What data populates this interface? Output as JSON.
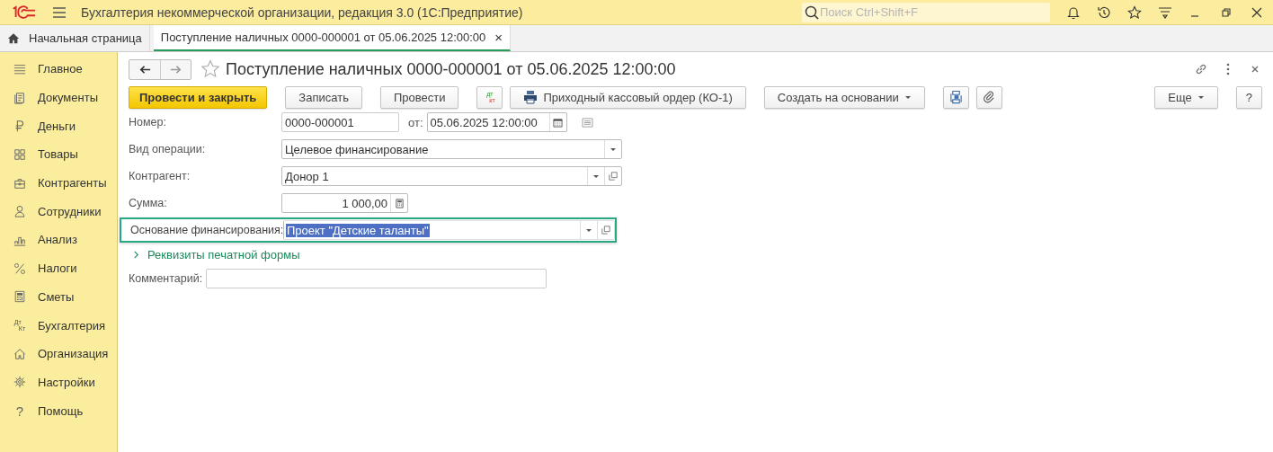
{
  "window": {
    "title": "Бухгалтерия некоммерческой организации, редакция 3.0  (1С:Предприятие)",
    "search_placeholder": "Поиск Ctrl+Shift+F"
  },
  "tabs": [
    {
      "kind": "home",
      "label": "Начальная страница",
      "selected": false
    },
    {
      "kind": "doc",
      "label": "Поступление наличных 0000-000001 от 05.06.2025 12:00:00",
      "selected": true,
      "close": "×"
    }
  ],
  "sidebar": {
    "items": [
      {
        "kind": "menu",
        "label": "Главное"
      },
      {
        "kind": "docs",
        "label": "Документы"
      },
      {
        "kind": "ruble",
        "label": "Деньги"
      },
      {
        "kind": "grid",
        "label": "Товары"
      },
      {
        "kind": "case",
        "label": "Контрагенты"
      },
      {
        "kind": "person",
        "label": "Сотрудники"
      },
      {
        "kind": "chart",
        "label": "Анализ"
      },
      {
        "kind": "percent",
        "label": "Налоги"
      },
      {
        "kind": "calc",
        "label": "Сметы"
      },
      {
        "kind": "dtkt",
        "label": "Бухгалтерия",
        "glyph_top": "Дт",
        "glyph_bottom": "Кт"
      },
      {
        "kind": "house",
        "label": "Организация"
      },
      {
        "kind": "gear",
        "label": "Настройки"
      },
      {
        "kind": "help",
        "label": "Помощь",
        "glyph": "?"
      }
    ]
  },
  "form": {
    "title": "Поступление наличных 0000-000001 от 05.06.2025 12:00:00",
    "favorite": false,
    "toolbar": [
      {
        "kind": "primary",
        "label": "Провести и закрыть"
      },
      {
        "kind": "button",
        "label": "Записать"
      },
      {
        "kind": "button",
        "label": "Провести"
      },
      {
        "kind": "dtkt",
        "glyph_top": "дт",
        "glyph_bottom": "кт"
      },
      {
        "kind": "print",
        "label": "Приходный кассовый ордер (КО-1)"
      },
      {
        "kind": "dropdown",
        "label": "Создать на основании"
      },
      {
        "kind": "structure"
      },
      {
        "kind": "attach"
      }
    ],
    "toolbar_right": [
      {
        "kind": "dropdown",
        "label": "Еще"
      },
      {
        "kind": "button",
        "label": "?"
      }
    ],
    "number": {
      "label": "Номер:",
      "value": "0000-000001",
      "date_label": "от:",
      "date": "05.06.2025 12:00:00"
    },
    "fields": [
      {
        "kind": "select",
        "label": "Вид операции:",
        "value": "Целевое финансирование",
        "focused": false
      },
      {
        "kind": "lookup",
        "label": "Контрагент:",
        "value": "Донор 1",
        "focused": false
      },
      {
        "kind": "amount",
        "label": "Сумма:",
        "value": "1 000,00",
        "focused": false
      },
      {
        "kind": "lookup",
        "label": "Основание финансирования:",
        "value": "Проект \"Детские таланты\"",
        "focused": true
      }
    ],
    "group": {
      "label": "Реквизиты печатной формы",
      "expanded": false
    },
    "comment": {
      "label": "Комментарий:"
    }
  }
}
